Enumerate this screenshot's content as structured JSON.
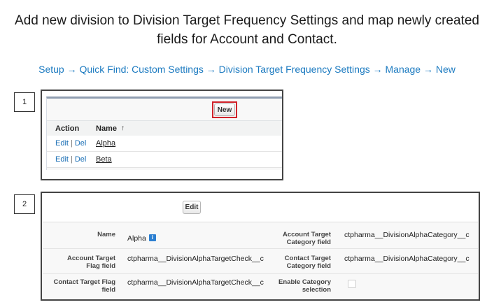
{
  "heading": {
    "line1": "Add new division to Division Target Frequency Settings and map newly created",
    "line2": "fields for Account and Contact."
  },
  "path_text": "Setup → Quick Find: Custom Settings → Division Target Frequency Settings → Manage → New",
  "step1": {
    "label": "1",
    "new_button": "New",
    "columns": {
      "action": "Action",
      "name": "Name",
      "sort_icon": "↑"
    },
    "rows": [
      {
        "edit": "Edit",
        "sep": "|",
        "del": "Del",
        "name": "Alpha"
      },
      {
        "edit": "Edit",
        "sep": "|",
        "del": "Del",
        "name": "Beta"
      }
    ]
  },
  "step2": {
    "label": "2",
    "edit_button": "Edit",
    "fields": {
      "name_label": "Name",
      "name_value": "Alpha",
      "info_icon": "i",
      "acct_cat_label_1": "Account Target",
      "acct_cat_label_2": "Category field",
      "acct_cat_value": "ctpharma__DivisionAlphaCategory__c",
      "acct_flag_label_1": "Account Target",
      "acct_flag_label_2": "Flag field",
      "acct_flag_value": "ctpharma__DivisionAlphaTargetCheck__c",
      "cont_cat_label_1": "Contact Target",
      "cont_cat_label_2": "Category field",
      "cont_cat_value": "ctpharma__DivisionAlphaCategory__c",
      "cont_flag_label_1": "Contact Target Flag",
      "cont_flag_label_2": "field",
      "cont_flag_value": "ctpharma__DivisionAlphaTargetCheck__c",
      "enable_cat_label_1": "Enable Category",
      "enable_cat_label_2": "selection"
    }
  }
}
